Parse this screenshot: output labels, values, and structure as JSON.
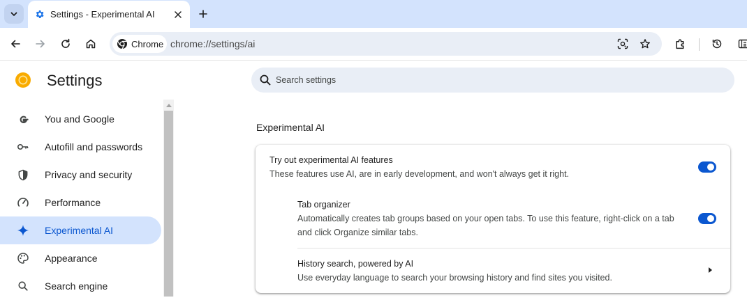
{
  "tab": {
    "title": "Settings - Experimental AI"
  },
  "toolbar": {
    "chip_label": "Chrome",
    "url": "chrome://settings/ai"
  },
  "header": {
    "title": "Settings"
  },
  "search": {
    "placeholder": "Search settings"
  },
  "sidebar": {
    "items": [
      {
        "label": "You and Google",
        "icon": "google-icon"
      },
      {
        "label": "Autofill and passwords",
        "icon": "key-icon"
      },
      {
        "label": "Privacy and security",
        "icon": "shield-icon"
      },
      {
        "label": "Performance",
        "icon": "gauge-icon"
      },
      {
        "label": "Experimental AI",
        "icon": "sparkle-icon",
        "active": true
      },
      {
        "label": "Appearance",
        "icon": "palette-icon"
      },
      {
        "label": "Search engine",
        "icon": "search-icon"
      }
    ]
  },
  "main": {
    "section_title": "Experimental AI",
    "rows": [
      {
        "title": "Try out experimental AI features",
        "description": "These features use AI, are in early development, and won't always get it right.",
        "toggle": "on"
      },
      {
        "title": "Tab organizer",
        "description": "Automatically creates tab groups based on your open tabs. To use this feature, right-click on a tab and click Organize similar tabs.",
        "toggle": "on"
      },
      {
        "title": "History search, powered by AI",
        "description": "Use everyday language to search your browsing history and find sites you visited."
      }
    ]
  },
  "colors": {
    "accent": "#0b57d0",
    "tabstrip": "#d3e3fd",
    "active_nav": "#d3e3fd"
  }
}
